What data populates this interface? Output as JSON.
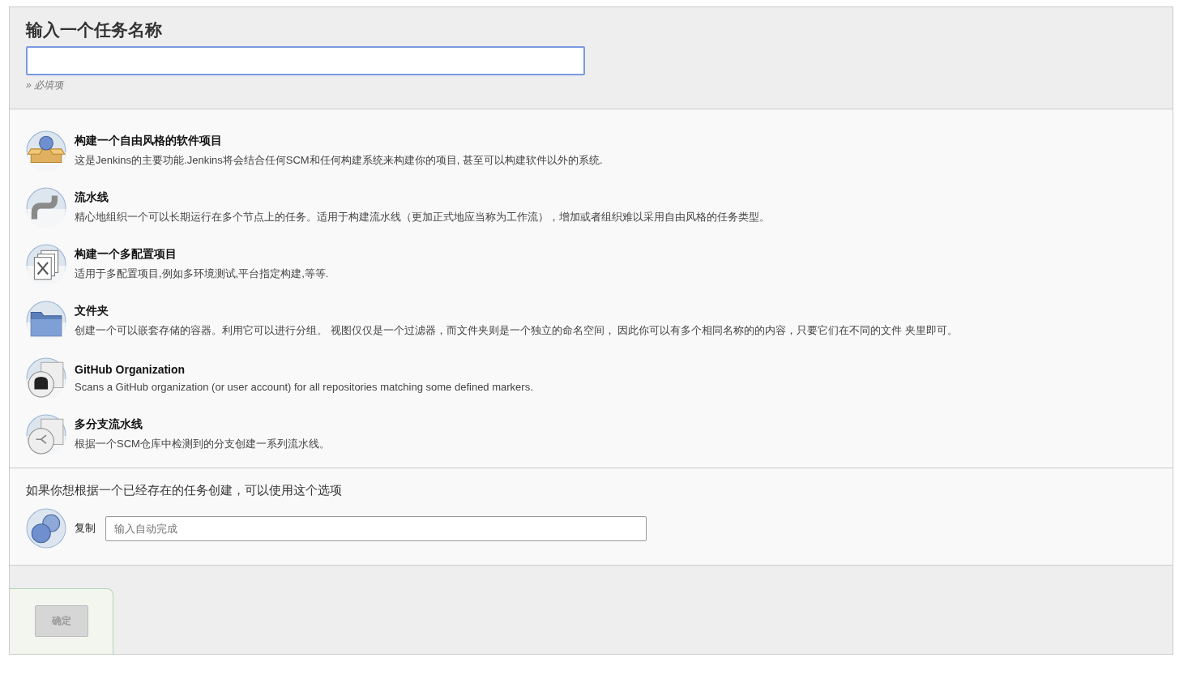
{
  "name_section": {
    "title": "输入一个任务名称",
    "hint": "» 必填项"
  },
  "item_types": [
    {
      "kind": "freestyle",
      "title": "构建一个自由风格的软件项目",
      "description": "这是Jenkins的主要功能.Jenkins将会结合任何SCM和任何构建系统来构建你的项目, 甚至可以构建软件以外的系统.",
      "selected": false
    },
    {
      "kind": "pipeline",
      "title": "流水线",
      "description": "精心地组织一个可以长期运行在多个节点上的任务。适用于构建流水线（更加正式地应当称为工作流），增加或者组织难以采用自由风格的任务类型。",
      "selected": false
    },
    {
      "kind": "matrix",
      "title": "构建一个多配置项目",
      "description": "适用于多配置项目,例如多环境测试,平台指定构建,等等.",
      "selected": false
    },
    {
      "kind": "folder",
      "title": "文件夹",
      "description": "创建一个可以嵌套存储的容器。利用它可以进行分组。 视图仅仅是一个过滤器，而文件夹则是一个独立的命名空间， 因此你可以有多个相同名称的的内容，只要它们在不同的文件 夹里即可。",
      "selected": false
    },
    {
      "kind": "github",
      "title": "GitHub Organization",
      "description": "Scans a GitHub organization (or user account) for all repositories matching some defined markers.",
      "selected": false
    },
    {
      "kind": "multibranch",
      "title": "多分支流水线",
      "description": "根据一个SCM仓库中检测到的分支创建一系列流水线。",
      "selected": false
    }
  ],
  "copy_section": {
    "prompt": "如果你想根据一个已经存在的任务创建，可以使用这个选项",
    "label": "复制",
    "placeholder": "输入自动完成"
  },
  "ok_button": {
    "label": "确定",
    "disabled": true
  }
}
